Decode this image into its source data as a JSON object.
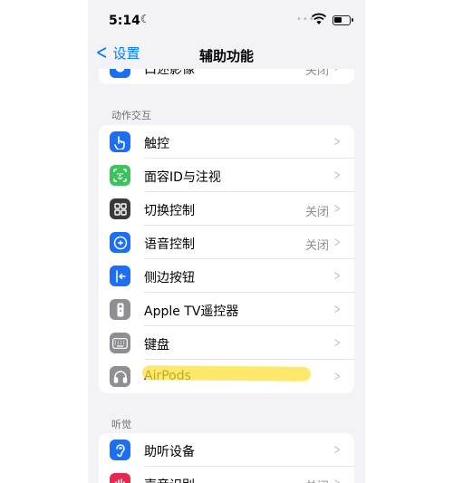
{
  "status_bar": {
    "time": "5:14"
  },
  "nav": {
    "back_label": "设置",
    "title": "辅助功能"
  },
  "top_partial": {
    "label": "口述影像",
    "value": "关闭"
  },
  "sections": [
    {
      "header": "动作交互",
      "rows": [
        {
          "label": "触控",
          "value": "",
          "icon": "hand-pointer-icon",
          "color": "#1a6ff5"
        },
        {
          "label": "面容ID与注视",
          "value": "",
          "icon": "face-id-icon",
          "color": "#3ac45b"
        },
        {
          "label": "切换控制",
          "value": "关闭",
          "icon": "switch-control-icon",
          "color": "#3a3a3c"
        },
        {
          "label": "语音控制",
          "value": "关闭",
          "icon": "voice-control-icon",
          "color": "#1a6ff5"
        },
        {
          "label": "侧边按钮",
          "value": "",
          "icon": "side-button-icon",
          "color": "#1a6ff5"
        },
        {
          "label": "Apple TV遥控器",
          "value": "",
          "icon": "tv-remote-icon",
          "color": "#8e8e93"
        },
        {
          "label": "键盘",
          "value": "",
          "icon": "keyboard-icon",
          "color": "#8e8e93"
        },
        {
          "label": "AirPods",
          "value": "",
          "icon": "airpods-icon",
          "color": "#8e8e93"
        }
      ]
    },
    {
      "header": "听觉",
      "rows": [
        {
          "label": "助听设备",
          "value": "",
          "icon": "hearing-devices-icon",
          "color": "#1a6ff5"
        },
        {
          "label": "声音识别",
          "value": "关闭",
          "icon": "sound-recognition-icon",
          "color": "#e8294d"
        }
      ]
    }
  ]
}
